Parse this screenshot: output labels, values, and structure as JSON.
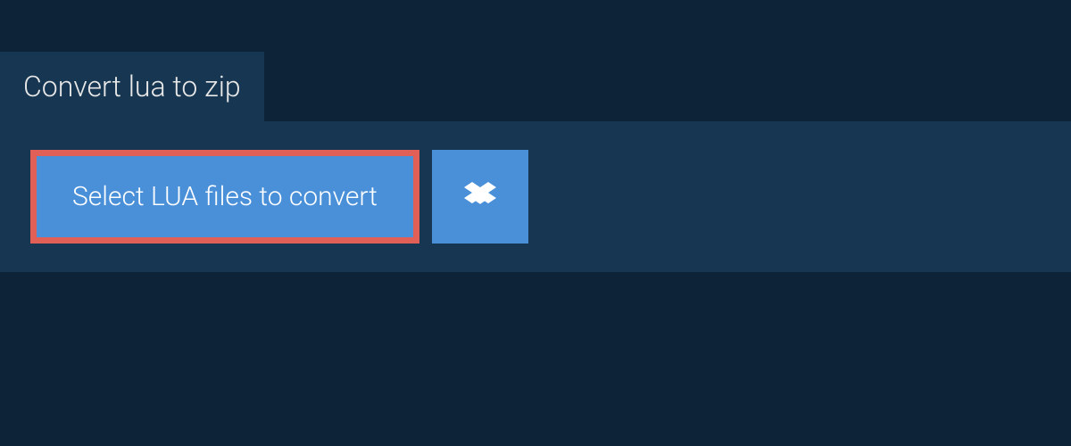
{
  "tab": {
    "label": "Convert lua to zip"
  },
  "actions": {
    "select_files_label": "Select LUA files to convert"
  },
  "colors": {
    "page_bg": "#0d2438",
    "panel_bg": "#163651",
    "button_bg": "#4a90d9",
    "highlight_border": "#e06058"
  }
}
